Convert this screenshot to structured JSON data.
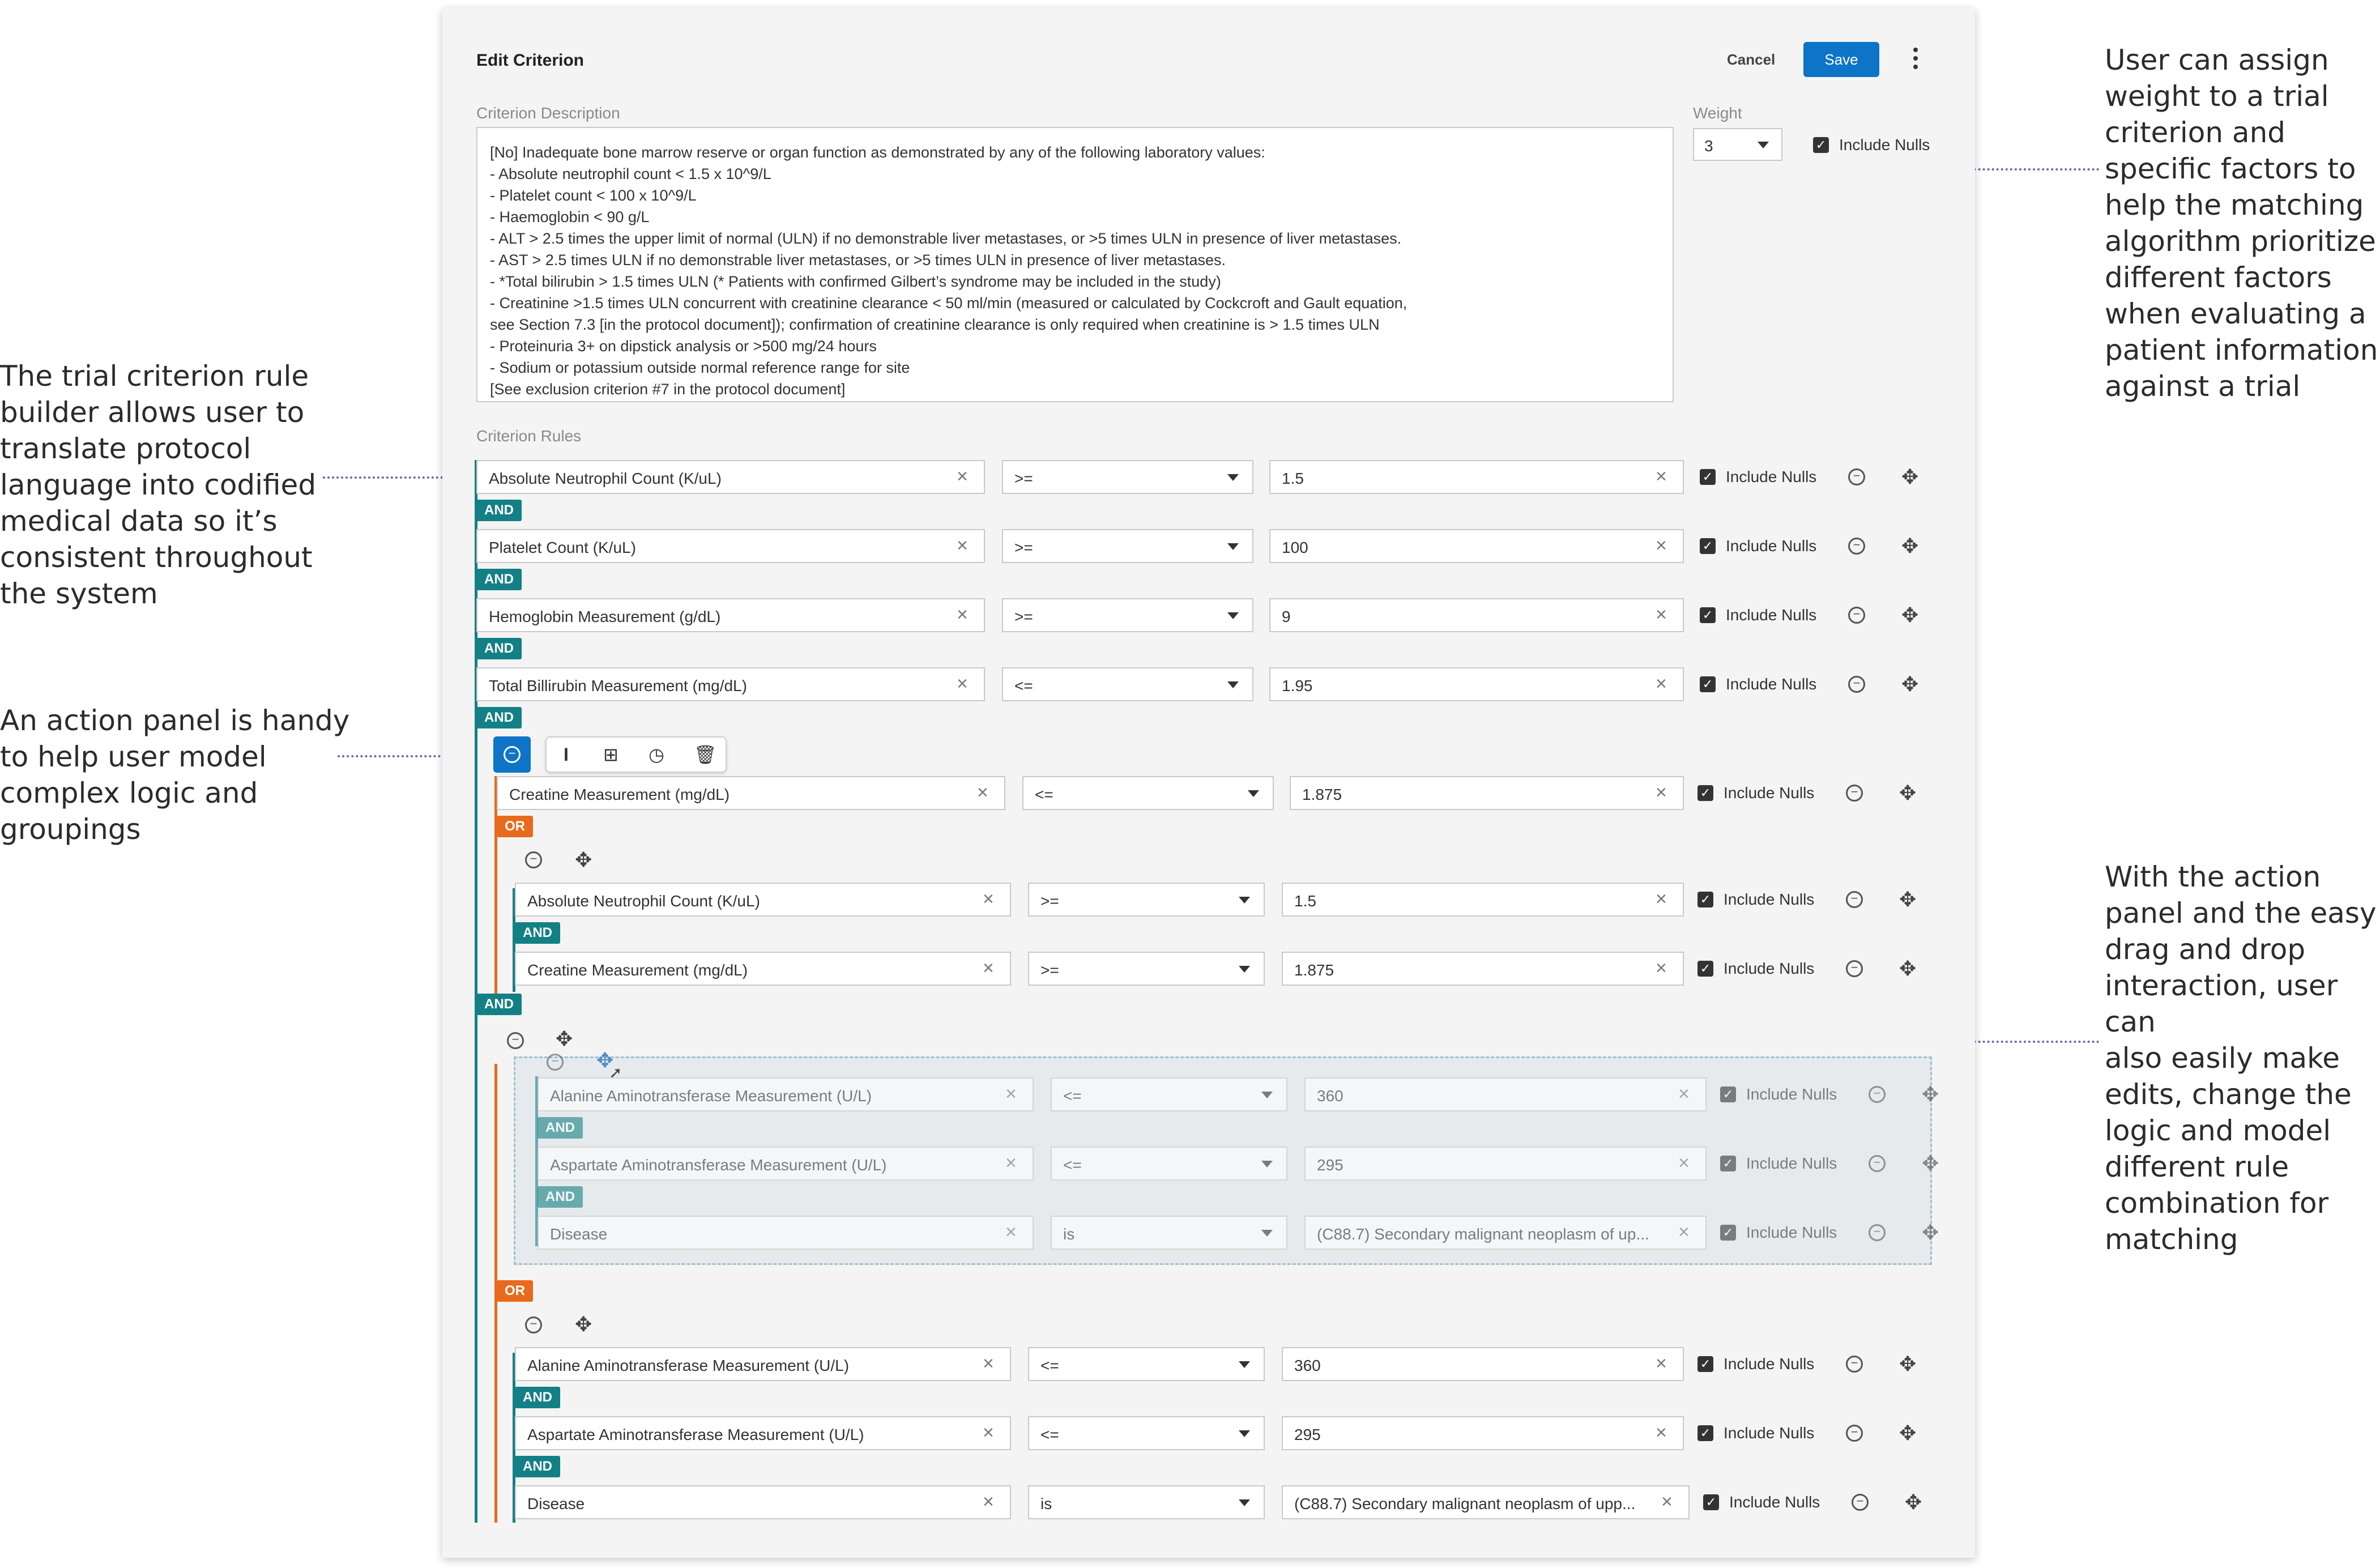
{
  "annotations": {
    "left_top": [
      "The trial criterion rule",
      "builder allows user to",
      "translate protocol",
      "language into codified",
      "medical data so it’s",
      "consistent throughout",
      "the system"
    ],
    "left_bottom": [
      "An action panel is handy",
      "to help user model",
      "complex logic and",
      "groupings"
    ],
    "right_top": [
      "User can assign",
      "weight to a trial",
      "criterion and",
      "specific factors to",
      "help the matching",
      "algorithm prioritize",
      "different factors",
      "when evaluating a",
      "patient information",
      "against a trial"
    ],
    "right_bottom": [
      "With the action",
      "panel and the easy",
      "drag and drop",
      "interaction, user can",
      "also easily make",
      "edits, change the",
      "logic and model",
      "different rule",
      "combination for",
      "matching"
    ]
  },
  "header": {
    "title": "Edit Criterion",
    "cancel_label": "Cancel",
    "save_label": "Save"
  },
  "description": {
    "label": "Criterion Description",
    "text": "[No] Inadequate bone marrow reserve or organ function as demonstrated by any of the following laboratory values:\n- Absolute neutrophil count < 1.5 x 10^9/L\n- Platelet count < 100 x 10^9/L\n- Haemoglobin < 90 g/L\n- ALT > 2.5 times the upper limit of normal (ULN) if no demonstrable liver metastases, or >5 times ULN in presence of liver metastases.\n- AST > 2.5 times ULN if no demonstrable liver metastases, or >5 times ULN in presence of liver metastases.\n- *Total bilirubin > 1.5 times ULN (* Patients with confirmed Gilbert’s syndrome may be included in the study)\n- Creatinine >1.5 times ULN concurrent with creatinine clearance < 50 ml/min (measured or calculated by Cockcroft and Gault equation,\nsee Section 7.3 [in the protocol document]); confirmation of creatinine clearance is only required when creatinine is > 1.5 times ULN\n- Proteinuria 3+ on dipstick analysis or >500 mg/24 hours\n- Sodium or potassium outside normal reference range for site\n[See exclusion criterion #7 in the protocol document]"
  },
  "weight": {
    "label": "Weight",
    "value": "3",
    "include_nulls": "Include Nulls"
  },
  "rules_label": "Criterion Rules",
  "include_nulls": "Include Nulls",
  "connectors": {
    "and": "AND",
    "or": "OR"
  },
  "rules": [
    {
      "name": "Absolute Neutrophil Count (K/uL)",
      "op": ">=",
      "value": "1.5"
    },
    {
      "name": "Platelet Count (K/uL)",
      "op": ">=",
      "value": "100"
    },
    {
      "name": "Hemoglobin Measurement (g/dL)",
      "op": ">=",
      "value": "9"
    },
    {
      "name": "Total Billirubin Measurement (mg/dL)",
      "op": "<=",
      "value": "1.95"
    },
    {
      "name": "Creatine Measurement (mg/dL)",
      "op": "<=",
      "value": "1.875"
    },
    {
      "name": "Absolute Neutrophil Count (K/uL)",
      "op": ">=",
      "value": "1.5"
    },
    {
      "name": "Creatine Measurement (mg/dL)",
      "op": ">=",
      "value": "1.875"
    },
    {
      "name": "Alanine Aminotransferase Measurement (U/L)",
      "op": "<=",
      "value": "360"
    },
    {
      "name": "Aspartate Aminotransferase Measurement (U/L)",
      "op": "<=",
      "value": "295"
    },
    {
      "name": "Disease",
      "op": "is",
      "value": "(C88.7) Secondary malignant neoplasm of up..."
    },
    {
      "name": "Alanine Aminotransferase Measurement (U/L)",
      "op": "<=",
      "value": "360"
    },
    {
      "name": "Aspartate Aminotransferase Measurement (U/L)",
      "op": "<=",
      "value": "295"
    },
    {
      "name": "Disease",
      "op": "is",
      "value": "(C88.7) Secondary malignant neoplasm of upp..."
    }
  ],
  "icons": {
    "kebab": "kebab-icon",
    "minus": "remove-circle-icon",
    "move": "move-icon",
    "cursor": "insert-cursor-icon",
    "hierarchy": "group-hierarchy-icon",
    "clock": "clock-icon",
    "trash": "trash-icon"
  },
  "colors": {
    "accent": "#0d74c7",
    "and": "#138086",
    "or": "#e96a1c",
    "annotation": "#7a5ea8"
  }
}
